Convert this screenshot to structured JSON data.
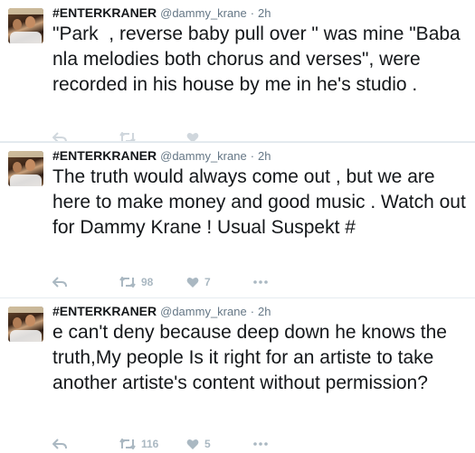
{
  "colors": {
    "name": "#14171a",
    "secondary": "#657786",
    "action": "#aab8c2",
    "divider": "#e6ecf0"
  },
  "tweets": [
    {
      "display_name": "#ENTERKRANER",
      "handle": "@dammy_krane",
      "separator": "·",
      "time": "2h",
      "text": "\"Park  , reverse baby pull over \" was mine \"Baba nla melodies both chorus and verses\", were recorded in his house by me in he's studio .",
      "retweets": "",
      "likes": ""
    },
    {
      "display_name": "#ENTERKRANER",
      "handle": "@dammy_krane",
      "separator": "·",
      "time": "2h",
      "text": "The truth would always come out , but we are here to make money and good music . Watch out for Dammy Krane ! Usual Suspekt #",
      "retweets": "98",
      "likes": "7"
    },
    {
      "display_name": "#ENTERKRANER",
      "handle": "@dammy_krane",
      "separator": "·",
      "time": "2h",
      "text": "e can't deny because deep down he knows the truth,My people Is it right for an artiste to take another artiste's content without permission?",
      "retweets": "116",
      "likes": "5"
    }
  ],
  "icons": {
    "reply": "reply-icon",
    "retweet": "retweet-icon",
    "like": "heart-icon",
    "more": "more-dots-icon"
  }
}
